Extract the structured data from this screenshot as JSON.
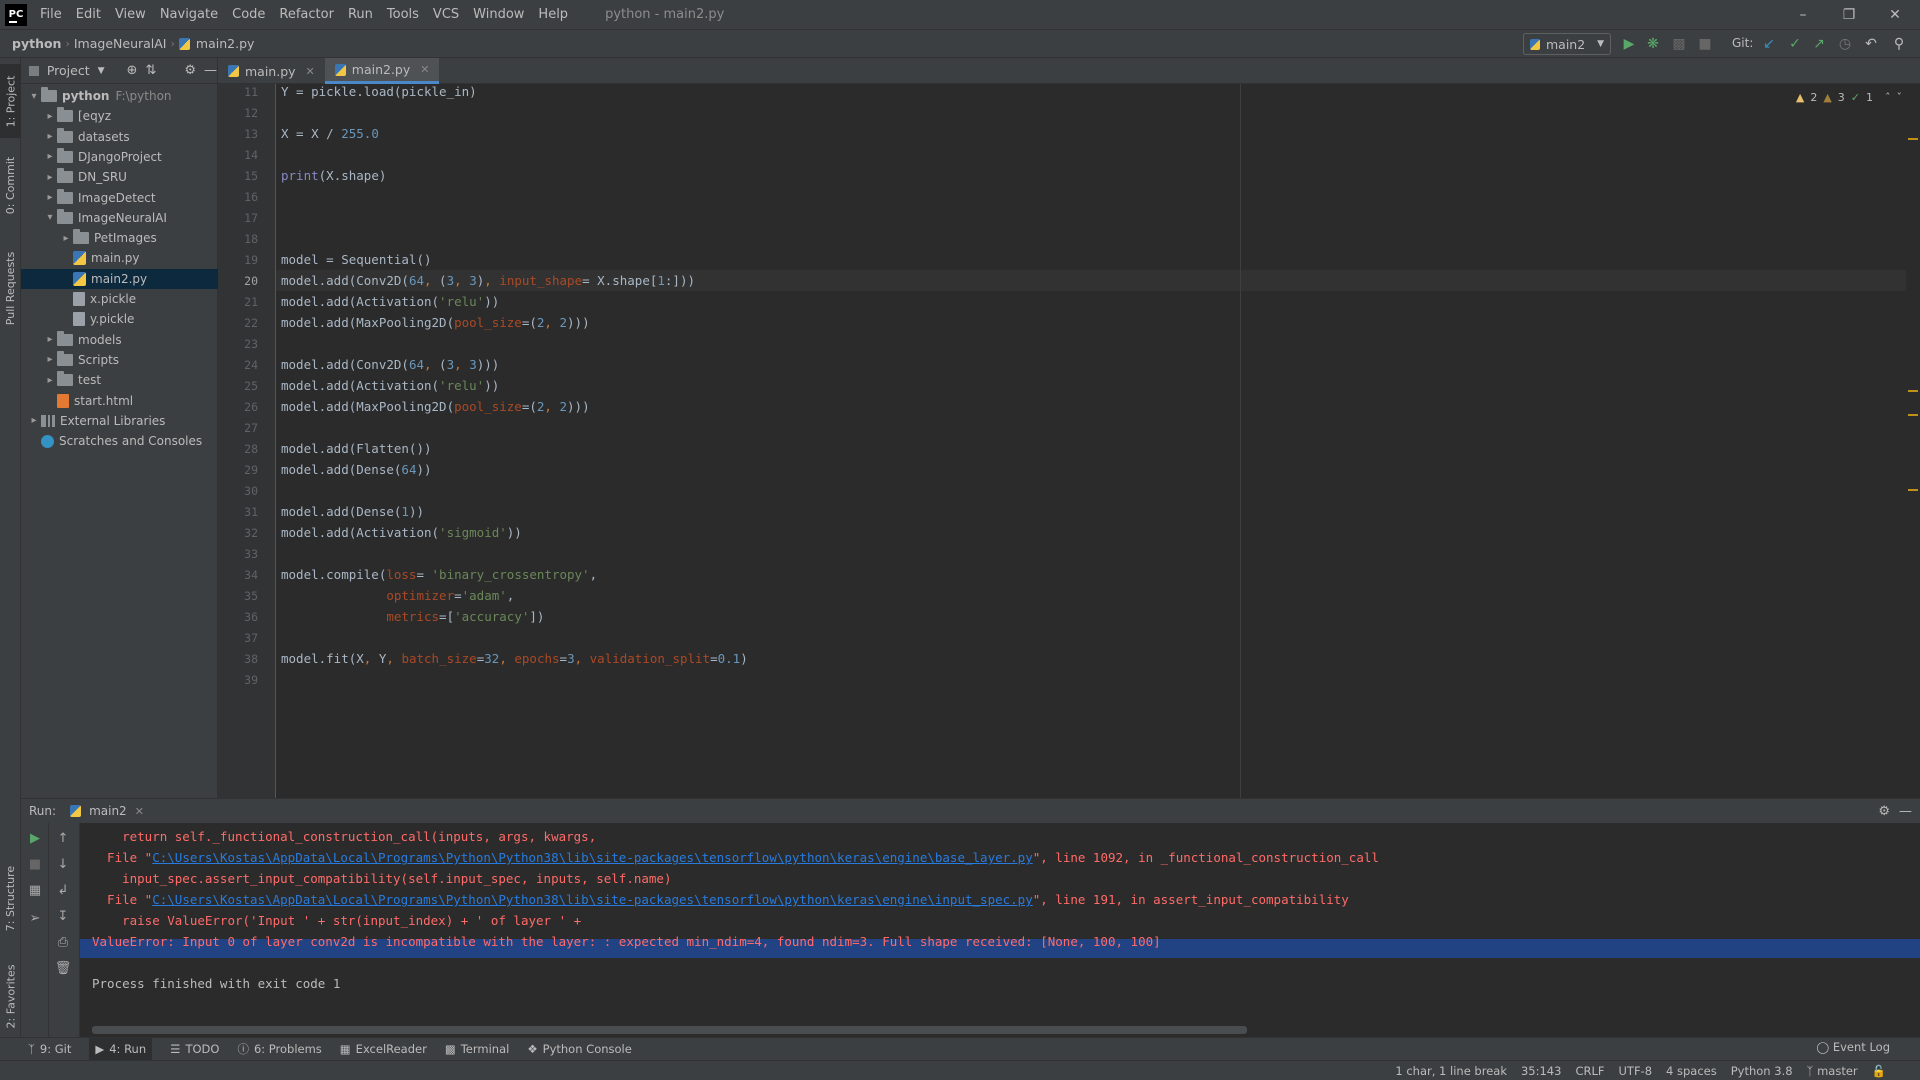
{
  "app": {
    "logo_text": "PC",
    "window_title": "python - main2.py",
    "menu": [
      "File",
      "Edit",
      "View",
      "Navigate",
      "Code",
      "Refactor",
      "Run",
      "Tools",
      "VCS",
      "Window",
      "Help"
    ]
  },
  "breadcrumb": [
    "python",
    "ImageNeuralAI",
    "main2.py"
  ],
  "navbar": {
    "run_config": "main2",
    "git_label": "Git:"
  },
  "left_strip": {
    "project": "1: Project",
    "commit": "0: Commit",
    "pull_requests": "Pull Requests",
    "structure": "7: Structure",
    "favorites": "2: Favorites"
  },
  "project_panel": {
    "title": "Project",
    "tree": [
      {
        "label": "python",
        "path": "F:\\python",
        "depth": 0,
        "type": "folder",
        "expanded": true
      },
      {
        "label": "[eqyz",
        "depth": 1,
        "type": "folder",
        "expanded": false
      },
      {
        "label": "datasets",
        "depth": 1,
        "type": "folder",
        "expanded": false
      },
      {
        "label": "DJangoProject",
        "depth": 1,
        "type": "folder",
        "expanded": false
      },
      {
        "label": "DN_SRU",
        "depth": 1,
        "type": "folder",
        "expanded": false
      },
      {
        "label": "ImageDetect",
        "depth": 1,
        "type": "folder",
        "expanded": false
      },
      {
        "label": "ImageNeuralAI",
        "depth": 1,
        "type": "folder",
        "expanded": true
      },
      {
        "label": "PetImages",
        "depth": 2,
        "type": "folder",
        "expanded": false
      },
      {
        "label": "main.py",
        "depth": 2,
        "type": "py"
      },
      {
        "label": "main2.py",
        "depth": 2,
        "type": "py",
        "selected": true
      },
      {
        "label": "x.pickle",
        "depth": 2,
        "type": "pickle"
      },
      {
        "label": "y.pickle",
        "depth": 2,
        "type": "pickle"
      },
      {
        "label": "models",
        "depth": 1,
        "type": "folder",
        "expanded": false
      },
      {
        "label": "Scripts",
        "depth": 1,
        "type": "folder",
        "expanded": false
      },
      {
        "label": "test",
        "depth": 1,
        "type": "folder",
        "expanded": false
      },
      {
        "label": "start.html",
        "depth": 1,
        "type": "html"
      },
      {
        "label": "External Libraries",
        "depth": 0,
        "type": "lib",
        "expanded": false
      },
      {
        "label": "Scratches and Consoles",
        "depth": 0,
        "type": "scratch"
      }
    ]
  },
  "editor": {
    "tabs": [
      {
        "label": "main.py",
        "active": false
      },
      {
        "label": "main2.py",
        "active": true
      }
    ],
    "inspections": {
      "warnings": "2",
      "weak_warnings": "3",
      "ok": "1"
    },
    "current_line": 20,
    "lines": [
      {
        "n": "11",
        "text": "Y = pickle.load(pickle_in)"
      },
      {
        "n": "12",
        "text": ""
      },
      {
        "n": "13",
        "text": "X = X / 255.0"
      },
      {
        "n": "14",
        "text": ""
      },
      {
        "n": "15",
        "text": "print(X.shape)"
      },
      {
        "n": "16",
        "text": ""
      },
      {
        "n": "17",
        "text": ""
      },
      {
        "n": "18",
        "text": ""
      },
      {
        "n": "19",
        "text": "model = Sequential()"
      },
      {
        "n": "20",
        "text": "model.add(Conv2D(64, (3, 3), input_shape= X.shape[1:]))"
      },
      {
        "n": "21",
        "text": "model.add(Activation('relu'))"
      },
      {
        "n": "22",
        "text": "model.add(MaxPooling2D(pool_size=(2, 2)))"
      },
      {
        "n": "23",
        "text": ""
      },
      {
        "n": "24",
        "text": "model.add(Conv2D(64, (3, 3)))"
      },
      {
        "n": "25",
        "text": "model.add(Activation('relu'))"
      },
      {
        "n": "26",
        "text": "model.add(MaxPooling2D(pool_size=(2, 2)))"
      },
      {
        "n": "27",
        "text": ""
      },
      {
        "n": "28",
        "text": "model.add(Flatten())"
      },
      {
        "n": "29",
        "text": "model.add(Dense(64))"
      },
      {
        "n": "30",
        "text": ""
      },
      {
        "n": "31",
        "text": "model.add(Dense(1))"
      },
      {
        "n": "32",
        "text": "model.add(Activation('sigmoid'))"
      },
      {
        "n": "33",
        "text": ""
      },
      {
        "n": "34",
        "text": "model.compile(loss= 'binary_crossentropy',"
      },
      {
        "n": "35",
        "text": "              optimizer='adam',"
      },
      {
        "n": "36",
        "text": "              metrics=['accuracy'])"
      },
      {
        "n": "37",
        "text": ""
      },
      {
        "n": "38",
        "text": "model.fit(X, Y, batch_size=32, epochs=3, validation_split=0.1)"
      },
      {
        "n": "39",
        "text": ""
      }
    ]
  },
  "run_panel": {
    "label": "Run:",
    "tab": "main2",
    "console": [
      {
        "kind": "err",
        "text": "    return self._functional_construction_call(inputs, args, kwargs,"
      },
      {
        "kind": "err",
        "prefix": "  File \"",
        "link": "C:\\Users\\Kostas\\AppData\\Local\\Programs\\Python\\Python38\\lib\\site-packages\\tensorflow\\python\\keras\\engine\\base_layer.py",
        "suffix": "\", line 1092, in _functional_construction_call"
      },
      {
        "kind": "err",
        "text": "    input_spec.assert_input_compatibility(self.input_spec, inputs, self.name)"
      },
      {
        "kind": "err",
        "prefix": "  File \"",
        "link": "C:\\Users\\Kostas\\AppData\\Local\\Programs\\Python\\Python38\\lib\\site-packages\\tensorflow\\python\\keras\\engine\\input_spec.py",
        "suffix": "\", line 191, in assert_input_compatibility"
      },
      {
        "kind": "err",
        "text": "    raise ValueError('Input ' + str(input_index) + ' of layer ' +"
      },
      {
        "kind": "err",
        "text": "ValueError: Input 0 of layer conv2d is incompatible with the layer: : expected min_ndim=4, found ndim=3. Full shape received: [None, 100, 100]"
      },
      {
        "kind": "blank",
        "text": ""
      },
      {
        "kind": "plain",
        "text": "Process finished with exit code 1"
      }
    ]
  },
  "bottom_tools": [
    "9: Git",
    "4: Run",
    "TODO",
    "6: Problems",
    "ExcelReader",
    "Terminal",
    "Python Console"
  ],
  "event_log": "Event Log",
  "status": {
    "selection": "1 char, 1 line break",
    "position": "35:143",
    "line_sep": "CRLF",
    "encoding": "UTF-8",
    "indent": "4 spaces",
    "interpreter": "Python 3.8",
    "branch": "master"
  },
  "colors": {
    "bg": "#2b2b2b",
    "panel": "#3c3f41",
    "error": "#ff6b68",
    "link": "#287bde",
    "selection": "#214283"
  }
}
